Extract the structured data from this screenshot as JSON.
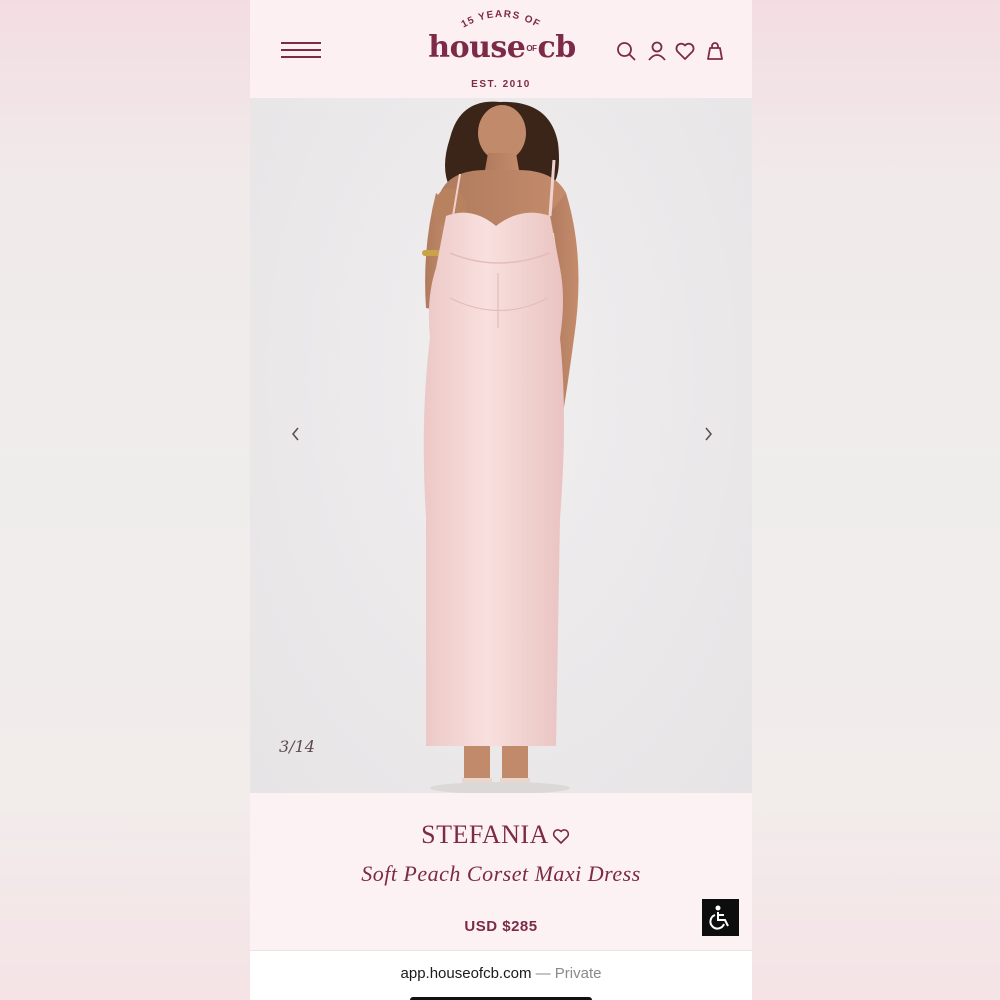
{
  "header": {
    "logo_top": "15 YEARS OF",
    "logo_main": "house",
    "logo_of": "OF",
    "logo_cb": "cb",
    "logo_bottom": "EST. 2010",
    "icons": [
      "menu-icon",
      "search-icon",
      "account-icon",
      "wishlist-heart-icon",
      "shopping-bag-icon"
    ]
  },
  "gallery": {
    "counter": "3/14",
    "prev_icon": "chevron-left-icon",
    "next_icon": "chevron-right-icon"
  },
  "product": {
    "name": "STEFANIA",
    "subtitle": "Soft Peach Corset Maxi Dress",
    "price": "USD $285",
    "heart_icon": "heart-outline-icon",
    "accessibility_icon": "wheelchair-icon"
  },
  "browser": {
    "url": "app.houseofcb.com",
    "separator": "—",
    "mode": "Private"
  },
  "colors": {
    "brand": "#7d2a49",
    "header_bg": "#fcf0f2",
    "gallery_bg": "#ebe9ea",
    "dress": "#f3d6d4"
  }
}
